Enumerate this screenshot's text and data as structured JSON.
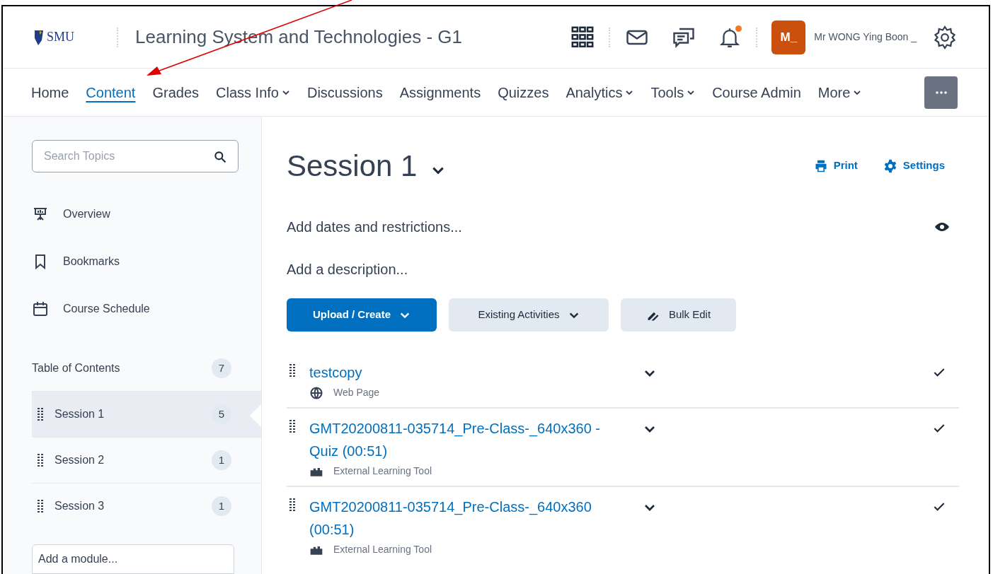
{
  "header": {
    "logo_text": "SMU",
    "course_title": "Learning System and Technologies - G1",
    "user_initials": "M_",
    "user_name": "Mr WONG Ying Boon _",
    "notification": true
  },
  "nav": [
    {
      "label": "Home",
      "selected": false,
      "dropdown": false
    },
    {
      "label": "Content",
      "selected": true,
      "dropdown": false
    },
    {
      "label": "Grades",
      "selected": false,
      "dropdown": false
    },
    {
      "label": "Class Info",
      "selected": false,
      "dropdown": true
    },
    {
      "label": "Discussions",
      "selected": false,
      "dropdown": false
    },
    {
      "label": "Assignments",
      "selected": false,
      "dropdown": false
    },
    {
      "label": "Quizzes",
      "selected": false,
      "dropdown": false
    },
    {
      "label": "Analytics",
      "selected": false,
      "dropdown": true
    },
    {
      "label": "Tools",
      "selected": false,
      "dropdown": true
    },
    {
      "label": "Course Admin",
      "selected": false,
      "dropdown": false
    },
    {
      "label": "More",
      "selected": false,
      "dropdown": true
    }
  ],
  "sidebar": {
    "search": {
      "placeholder": "Search Topics"
    },
    "links": [
      {
        "kind": "overview",
        "label": "Overview"
      },
      {
        "kind": "bookmarks",
        "label": "Bookmarks"
      },
      {
        "kind": "schedule",
        "label": "Course Schedule"
      }
    ],
    "toc": {
      "label": "Table of Contents",
      "count": "7"
    },
    "modules": [
      {
        "label": "Session 1",
        "count": "5",
        "selected": true
      },
      {
        "label": "Session 2",
        "count": "1",
        "selected": false
      },
      {
        "label": "Session 3",
        "count": "1",
        "selected": false
      }
    ],
    "add_module": {
      "placeholder": "Add a module..."
    }
  },
  "content": {
    "title": "Session 1",
    "actions": [
      {
        "kind": "print",
        "label": "Print"
      },
      {
        "kind": "settings",
        "label": "Settings"
      }
    ],
    "dates_placeholder": "Add dates and restrictions...",
    "description_placeholder": "Add a description...",
    "buttons": [
      {
        "kind": "primary",
        "label": "Upload / Create"
      },
      {
        "kind": "dropdown",
        "label": "Existing Activities"
      },
      {
        "kind": "bulk",
        "label": "Bulk Edit"
      }
    ],
    "items": [
      {
        "kind": "web",
        "title": "testcopy",
        "type": "Web Page"
      },
      {
        "kind": "tool",
        "title": "GMT20200811-035714_Pre-Class-_640x360 - Quiz (00:51)",
        "type": "External Learning Tool"
      },
      {
        "kind": "tool",
        "title": "GMT20200811-035714_Pre-Class-_640x360 (00:51)",
        "type": "External Learning Tool"
      }
    ]
  }
}
